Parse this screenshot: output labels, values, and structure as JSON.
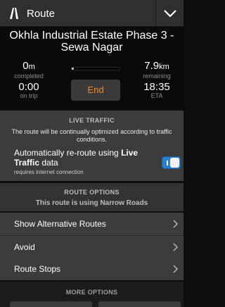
{
  "header": {
    "title": "Route",
    "icon": "road-icon",
    "menu_icon": "chevron-down-icon"
  },
  "trip": {
    "destination": "Okhla Industrial Estate Phase 3 - Sewa Nagar",
    "completed_value": "0",
    "completed_unit": "m",
    "completed_label": "completed",
    "remaining_value": "7.9",
    "remaining_unit": "km",
    "remaining_label": "remaining",
    "time_on_trip": "0:00",
    "time_on_trip_label": "on trip",
    "eta": "18:35",
    "eta_label": "ETA",
    "end_label": "End",
    "progress_fraction": 0.0
  },
  "live_traffic": {
    "title": "LIVE TRAFFIC",
    "description": "The route will be continually optimized according to traffic conditions.",
    "reroute_text_1": "Automatically re-route using ",
    "reroute_bold": "Live Traffic",
    "reroute_text_2": " data",
    "note": "requires internet connection",
    "toggle_on": true,
    "toggle_color": "#2a7fcf"
  },
  "route_options": {
    "title": "ROUTE OPTIONS",
    "subtitle": "This route is using Narrow Roads",
    "items": [
      {
        "label": "Show Alternative Routes"
      },
      {
        "label": "Avoid"
      },
      {
        "label": "Route Stops"
      }
    ]
  },
  "more_options": {
    "title": "MORE OPTIONS"
  },
  "colors": {
    "accent": "#f08a2a",
    "toggle": "#2a7fcf"
  }
}
